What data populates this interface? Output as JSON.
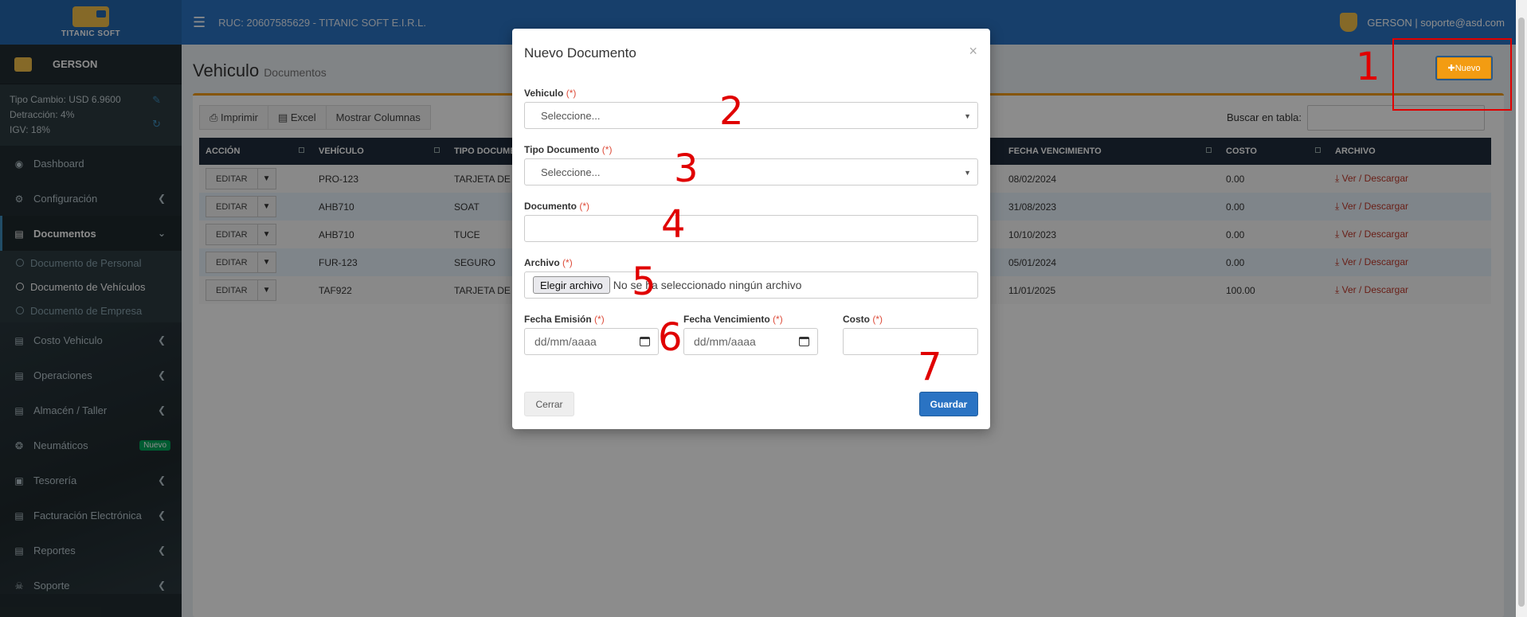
{
  "topbar": {
    "logo_text": "TITANIC SOFT",
    "ruc": "RUC: 20607585629 - TITANIC SOFT E.I.R.L.",
    "user": "GERSON | soporte@asd.com"
  },
  "sidebar": {
    "profile_name": "GERSON",
    "tipo_cambio": "Tipo Cambio: USD 6.9600",
    "detraccion": "Detracción: 4%",
    "igv": "IGV: 18%",
    "items": [
      {
        "label": "Dashboard",
        "icon": "dashboard-icon"
      },
      {
        "label": "Configuración",
        "icon": "gears-icon"
      },
      {
        "label": "Documentos",
        "icon": "book-icon"
      },
      {
        "label": "Costo Vehiculo",
        "icon": "file-icon"
      },
      {
        "label": "Operaciones",
        "icon": "file-icon"
      },
      {
        "label": "Almacén / Taller",
        "icon": "file-icon"
      },
      {
        "label": "Neumáticos",
        "icon": "tire-icon",
        "badge": "Nuevo"
      },
      {
        "label": "Tesorería",
        "icon": "money-icon"
      },
      {
        "label": "Facturación Electrónica",
        "icon": "file-icon"
      },
      {
        "label": "Reportes",
        "icon": "chart-icon"
      },
      {
        "label": "Soporte",
        "icon": "support-icon"
      }
    ],
    "sub_items": [
      {
        "label": "Documento de Personal"
      },
      {
        "label": "Documento de Vehículos"
      },
      {
        "label": "Documento de Empresa"
      }
    ]
  },
  "page": {
    "title": "Vehiculo",
    "subtitle": "Documentos",
    "nuevo_label": "Nuevo",
    "search_label": "Buscar en tabla:"
  },
  "toolbar": {
    "imprimir": "Imprimir",
    "excel": "Excel",
    "mostrar_columnas": "Mostrar Columnas"
  },
  "table": {
    "headers": {
      "accion": "ACCIÓN",
      "vehiculo": "VEHÍCULO",
      "tipo": "TIPO DOCUME",
      "fecha_venc": "FECHA VENCIMIENTO",
      "costo": "COSTO",
      "archivo": "ARCHIVO"
    },
    "editar_label": "EDITAR",
    "download_label": "Ver / Descargar",
    "rows": [
      {
        "vehiculo": "PRO-123",
        "tipo": "TARJETA DE P",
        "fecha": "08/02/2024",
        "costo": "0.00"
      },
      {
        "vehiculo": "AHB710",
        "tipo": "SOAT",
        "fecha": "31/08/2023",
        "costo": "0.00"
      },
      {
        "vehiculo": "AHB710",
        "tipo": "TUCE",
        "fecha": "10/10/2023",
        "costo": "0.00"
      },
      {
        "vehiculo": "FUR-123",
        "tipo": "SEGURO",
        "fecha": "05/01/2024",
        "costo": "0.00"
      },
      {
        "vehiculo": "TAF922",
        "tipo": "TARJETA DE P",
        "fecha": "11/01/2025",
        "costo": "100.00"
      }
    ]
  },
  "modal": {
    "title": "Nuevo Documento",
    "close": "×",
    "required_mark": "(*)",
    "vehiculo_label": "Vehiculo",
    "vehiculo_value": "Seleccione...",
    "tipo_label": "Tipo Documento",
    "tipo_value": "Seleccione...",
    "documento_label": "Documento",
    "archivo_label": "Archivo",
    "file_button": "Elegir archivo",
    "file_status": "No se ha seleccionado ningún archivo",
    "fecha_emision_label": "Fecha Emisión",
    "fecha_venc_label": "Fecha Vencimiento",
    "date_placeholder": "dd/mm/aaaa",
    "costo_label": "Costo",
    "cerrar": "Cerrar",
    "guardar": "Guardar"
  },
  "annotations": [
    "1",
    "2",
    "3",
    "4",
    "5",
    "6",
    "7"
  ],
  "colors": {
    "topbar": "#2a73c3",
    "sidebar": "#222d32",
    "accent_orange": "#f39c12",
    "annotation_red": "#e00000",
    "primary_button": "#2a73c3"
  }
}
